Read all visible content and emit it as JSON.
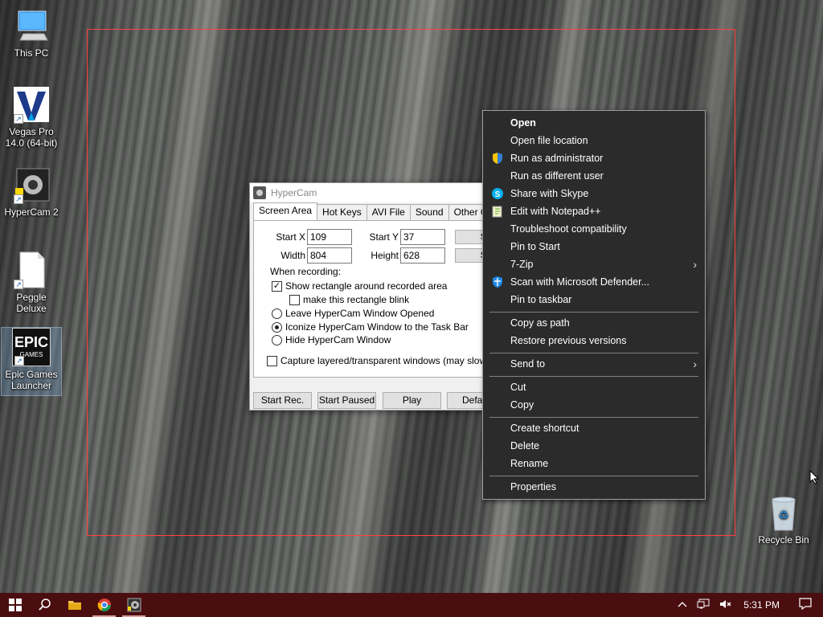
{
  "desktop": {
    "icons": [
      {
        "label": "This PC"
      },
      {
        "label": "Vegas Pro 14.0 (64-bit)"
      },
      {
        "label": "HyperCam 2"
      },
      {
        "label": "Peggle Deluxe"
      },
      {
        "label": "Epic Games Launcher",
        "logo_text": "EPIC",
        "logo_sub": "GAMES"
      },
      {
        "label": "Recycle Bin"
      }
    ]
  },
  "hypercam": {
    "title": "HyperCam",
    "tabs": [
      "Screen Area",
      "Hot Keys",
      "AVI File",
      "Sound",
      "Other Options"
    ],
    "start_x_label": "Start X",
    "start_x_value": "109",
    "start_y_label": "Start Y",
    "start_y_value": "37",
    "width_label": "Width",
    "width_value": "804",
    "height_label": "Height",
    "height_value": "628",
    "side_btn_1": "S",
    "side_btn_2": "S",
    "when_recording": "When recording:",
    "show_rect": "Show rectangle around recorded area",
    "blink_rect": "make this rectangle blink",
    "leave_opened": "Leave HyperCam Window Opened",
    "iconize": "Iconize HyperCam Window to the Task Bar",
    "hide": "Hide HyperCam Window",
    "capture_layered": "Capture layered/transparent windows (may slow down",
    "buttons": {
      "start_rec": "Start Rec.",
      "start_paused": "Start Paused",
      "play": "Play",
      "defaults": "Defau"
    }
  },
  "context_menu": {
    "items": [
      "Open",
      "Open file location",
      "Run as administrator",
      "Run as different user",
      "Share with Skype",
      "Edit with Notepad++",
      "Troubleshoot compatibility",
      "Pin to Start",
      "7-Zip",
      "Scan with Microsoft Defender...",
      "Pin to taskbar",
      "Copy as path",
      "Restore previous versions",
      "Send to",
      "Cut",
      "Copy",
      "Create shortcut",
      "Delete",
      "Rename",
      "Properties"
    ]
  },
  "taskbar": {
    "clock": "5:31 PM",
    "accent": "#4a0e10"
  },
  "colors": {
    "rect_border": "#ff4040",
    "menu_bg": "#2b2b2b"
  }
}
